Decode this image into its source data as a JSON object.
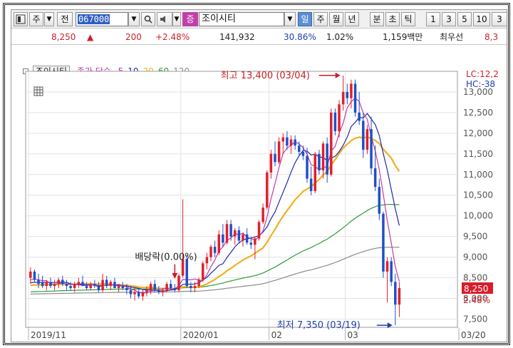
{
  "toolbar": {
    "type_label": "주",
    "prefix_label": "전",
    "code_value": "067000",
    "category_badge": "증",
    "stock_name": "조이시티",
    "periods": [
      "일",
      "주",
      "월",
      "년",
      "분",
      "초",
      "틱"
    ],
    "selected_period": "일",
    "numbers": [
      "1",
      "3",
      "5",
      "10",
      "3"
    ]
  },
  "quote": {
    "price": "8,250",
    "arrow": "▲",
    "change": "200",
    "change_pct": "+2.48%",
    "volume": "141,932",
    "ratio1": "30.86%",
    "ratio2": "1.02%",
    "amount": "1,159백만",
    "stock_type": "최우선",
    "extra": "8,3"
  },
  "legend": {
    "stock_name": "조이시티",
    "ma_label": "종가 단순",
    "ma_periods": [
      {
        "label": "5",
        "color": "#c03aa8"
      },
      {
        "label": "10",
        "color": "#1c2aa8"
      },
      {
        "label": "20",
        "color": "#f0b020"
      },
      {
        "label": "60",
        "color": "#2f9a3a"
      },
      {
        "label": "120",
        "color": "#8a8a8a"
      }
    ]
  },
  "chart_data": {
    "type": "candlestick",
    "ylim": [
      7300,
      13500
    ],
    "y_ticks": [
      7500,
      8000,
      8500,
      9000,
      9500,
      10000,
      10500,
      11000,
      11500,
      12000,
      12500,
      13000
    ],
    "y_tick_labels": [
      "7,500",
      "8,000",
      "8,500",
      "9,000",
      "9,500",
      "10,000",
      "10,500",
      "11,000",
      "11,500",
      "12,000",
      "12,500",
      "13,000"
    ],
    "x_labels": [
      {
        "index": 0,
        "label": "2019/11"
      },
      {
        "index": 38,
        "label": "2020/01"
      },
      {
        "index": 60,
        "label": "02"
      },
      {
        "index": 79,
        "label": "03"
      },
      {
        "index": 105,
        "label": "03/20"
      }
    ],
    "top_labels": {
      "lc": "LC:12,2",
      "hc": "HC:-38"
    },
    "current": {
      "price": "8,250",
      "pct": "2.48%",
      "value": 8250
    },
    "annotations": {
      "high": "최고 13,400 (03/04)",
      "low": "최저 7,350 (03/19)",
      "dividend": "배당락(0.00%)"
    },
    "candles": [
      [
        8500,
        8750,
        8350,
        8650
      ],
      [
        8650,
        8700,
        8400,
        8450
      ],
      [
        8450,
        8600,
        8250,
        8350
      ],
      [
        8400,
        8550,
        8250,
        8300
      ],
      [
        8300,
        8450,
        8200,
        8400
      ],
      [
        8400,
        8500,
        8250,
        8300
      ],
      [
        8300,
        8450,
        8200,
        8350
      ],
      [
        8350,
        8500,
        8250,
        8450
      ],
      [
        8450,
        8550,
        8300,
        8350
      ],
      [
        8350,
        8450,
        8200,
        8300
      ],
      [
        8300,
        8400,
        8200,
        8250
      ],
      [
        8250,
        8400,
        8150,
        8350
      ],
      [
        8350,
        8500,
        8250,
        8400
      ],
      [
        8400,
        8550,
        8300,
        8300
      ],
      [
        8300,
        8400,
        8200,
        8250
      ],
      [
        8250,
        8400,
        8200,
        8350
      ],
      [
        8350,
        8450,
        8250,
        8300
      ],
      [
        8300,
        8400,
        8150,
        8200
      ],
      [
        8200,
        8600,
        8150,
        8450
      ],
      [
        8450,
        8550,
        8250,
        8300
      ],
      [
        8300,
        8450,
        8200,
        8400
      ],
      [
        8400,
        8500,
        8250,
        8250
      ],
      [
        8250,
        8350,
        8150,
        8300
      ],
      [
        8300,
        8400,
        8200,
        8250
      ],
      [
        8250,
        8350,
        8100,
        8200
      ],
      [
        8200,
        8300,
        8000,
        8100
      ],
      [
        8100,
        8250,
        7950,
        8150
      ],
      [
        8150,
        8250,
        8000,
        8050
      ],
      [
        8050,
        8200,
        7950,
        8150
      ],
      [
        8150,
        8300,
        8050,
        8200
      ],
      [
        8200,
        8400,
        8100,
        8350
      ],
      [
        8350,
        8450,
        8150,
        8200
      ],
      [
        8200,
        8300,
        8100,
        8150
      ],
      [
        8150,
        8250,
        8050,
        8200
      ],
      [
        8200,
        8400,
        8150,
        8350
      ],
      [
        8350,
        8450,
        8200,
        8250
      ],
      [
        8250,
        8350,
        8150,
        8200
      ],
      [
        8200,
        8600,
        8150,
        8550
      ],
      [
        8550,
        10400,
        8500,
        8950
      ],
      [
        8950,
        9050,
        8250,
        8300
      ],
      [
        8300,
        8400,
        8150,
        8250
      ],
      [
        8250,
        8400,
        8150,
        8300
      ],
      [
        8300,
        8500,
        8250,
        8450
      ],
      [
        8450,
        8900,
        8400,
        8850
      ],
      [
        8850,
        9100,
        8700,
        9000
      ],
      [
        9000,
        9300,
        8900,
        9250
      ],
      [
        9250,
        9400,
        9000,
        9100
      ],
      [
        9100,
        9650,
        9050,
        9550
      ],
      [
        9550,
        9800,
        9250,
        9350
      ],
      [
        9350,
        9900,
        9300,
        9800
      ],
      [
        9800,
        9900,
        9400,
        9500
      ],
      [
        9500,
        9700,
        9300,
        9650
      ],
      [
        9650,
        9750,
        9350,
        9400
      ],
      [
        9400,
        9600,
        9250,
        9550
      ],
      [
        9550,
        9700,
        9300,
        9350
      ],
      [
        9350,
        9500,
        9200,
        9300
      ],
      [
        9300,
        9500,
        8950,
        9450
      ],
      [
        9450,
        9900,
        9400,
        9850
      ],
      [
        9850,
        10300,
        9800,
        10200
      ],
      [
        10200,
        11100,
        10150,
        11050
      ],
      [
        11050,
        11600,
        10900,
        11500
      ],
      [
        11500,
        11800,
        11200,
        11300
      ],
      [
        11300,
        11900,
        11250,
        11800
      ],
      [
        11800,
        12000,
        11500,
        11900
      ],
      [
        11900,
        12050,
        11600,
        11700
      ],
      [
        11700,
        11950,
        11500,
        11850
      ],
      [
        11850,
        11950,
        11600,
        11700
      ],
      [
        11700,
        11800,
        11450,
        11550
      ],
      [
        11550,
        11700,
        11350,
        11450
      ],
      [
        11450,
        11650,
        10800,
        10900
      ],
      [
        10900,
        11200,
        10500,
        10600
      ],
      [
        10600,
        11550,
        10550,
        11500
      ],
      [
        11500,
        11600,
        11000,
        11100
      ],
      [
        11100,
        11800,
        10900,
        11750
      ],
      [
        11750,
        11900,
        10800,
        11000
      ],
      [
        11000,
        12600,
        10950,
        12500
      ],
      [
        12500,
        12600,
        11950,
        12050
      ],
      [
        12050,
        12800,
        11900,
        12700
      ],
      [
        12700,
        13400,
        12550,
        13000
      ],
      [
        13000,
        13200,
        12700,
        12850
      ],
      [
        12850,
        13300,
        12600,
        13200
      ],
      [
        13200,
        13300,
        12400,
        12500
      ],
      [
        12500,
        13000,
        12200,
        12300
      ],
      [
        12300,
        12500,
        11400,
        11600
      ],
      [
        11600,
        12200,
        11500,
        12100
      ],
      [
        12100,
        12400,
        11000,
        11150
      ],
      [
        11150,
        11700,
        10600,
        10700
      ],
      [
        10700,
        10900,
        9900,
        10050
      ],
      [
        10050,
        10100,
        8500,
        8650
      ],
      [
        8650,
        9000,
        7900,
        8900
      ],
      [
        8900,
        9000,
        8300,
        8400
      ],
      [
        8400,
        8600,
        7350,
        7850
      ],
      [
        7850,
        8400,
        7550,
        8250
      ]
    ]
  }
}
